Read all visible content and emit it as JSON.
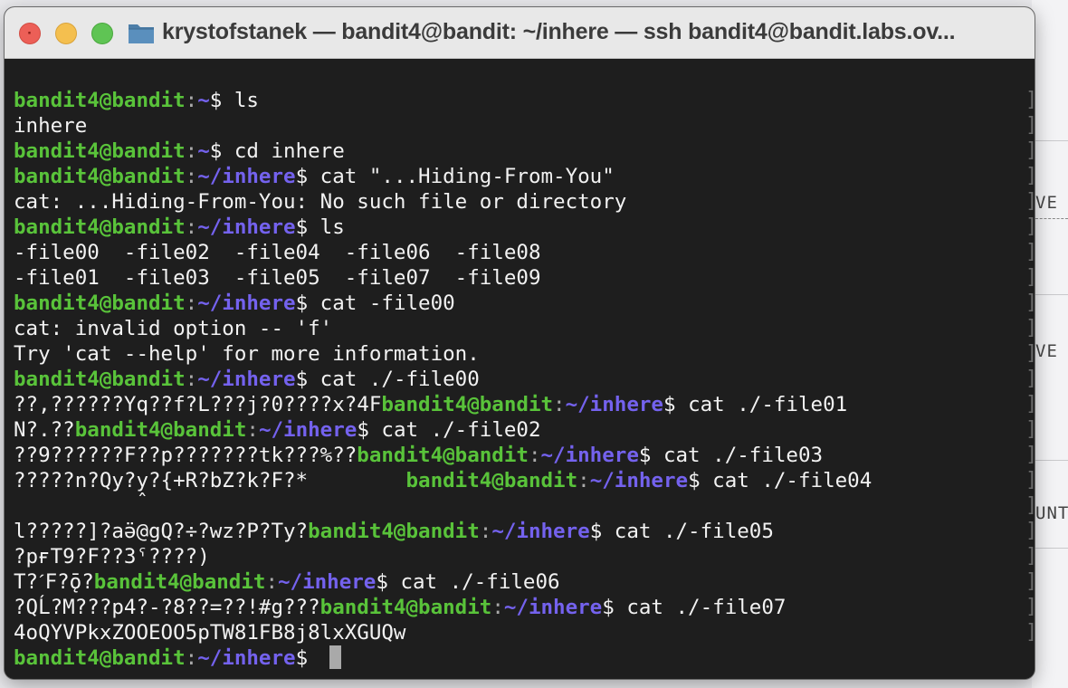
{
  "window": {
    "title": "krystofstanek — bandit4@bandit: ~/inhere — ssh bandit4@bandit.labs.ov...",
    "colors": {
      "prompt_user": "#59c33a",
      "prompt_path": "#7462ee",
      "text": "#f2f2f2",
      "background": "#1e1e1e"
    }
  },
  "background_app": {
    "fragments": [
      "VE U",
      "VE U",
      "UNT"
    ]
  },
  "prompt": {
    "user": "bandit4@bandit",
    "sep": ":",
    "home": "~",
    "path": "~/inhere",
    "sign": "$ "
  },
  "terminal": {
    "lines": [
      {
        "cmd": "ls"
      },
      {
        "out": "inhere"
      },
      {
        "cmd": "cd inhere"
      },
      {
        "cmd": "cat \"...Hiding-From-You\""
      },
      {
        "out": "cat: ...Hiding-From-You: No such file or directory"
      },
      {
        "cmd": "ls"
      },
      {
        "out": "-file00  -file02  -file04  -file06  -file08"
      },
      {
        "out": "-file01  -file03  -file05  -file07  -file09"
      },
      {
        "cmd": "cat -file00"
      },
      {
        "out": "cat: invalid option -- 'f'"
      },
      {
        "out": "Try 'cat --help' for more information."
      },
      {
        "cmd": "cat ./-file00"
      },
      {
        "pre": "??,??????Yq??f?L???j?0????x?4F",
        "cmd": "cat ./-file01"
      },
      {
        "pre": "N?.??",
        "cmd": "cat ./-file02"
      },
      {
        "pre": "??9??????F??p???????tk???%??",
        "cmd": "cat ./-file03"
      },
      {
        "pre": "?????n?Qy?y̭?{+R?bZ?k?F?*        ",
        "cmd": "cat ./-file04"
      },
      {
        "out": ""
      },
      {
        "pre": "l?????]?aӛ@gQ?÷?wz?P?Ty?",
        "cmd": "cat ./-file05"
      },
      {
        "out": "?pғT9?F??3ˤ????)"
      },
      {
        "pre": "T?ˊF?ǭ?",
        "cmd": "cat ./-file06"
      },
      {
        "pre": "?QĹ?M???p4?-?8??=??!#g???",
        "cmd": "cat ./-file07"
      },
      {
        "out": "4oQYVPkxZOOEOO5pTW81FB8j8lxXGUQw"
      }
    ]
  }
}
